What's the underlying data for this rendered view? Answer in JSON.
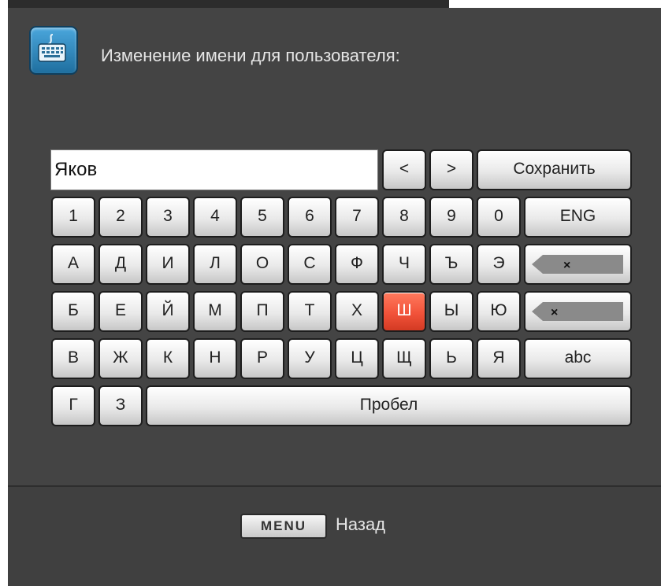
{
  "title": "Изменение имени для пользователя:",
  "input": {
    "value": "Яков"
  },
  "controls": {
    "left": "<",
    "right": ">",
    "save": "Сохранить"
  },
  "digits": [
    "1",
    "2",
    "3",
    "4",
    "5",
    "6",
    "7",
    "8",
    "9",
    "0"
  ],
  "lang_label": "ENG",
  "letters_row1": [
    "А",
    "Д",
    "И",
    "Л",
    "О",
    "С",
    "Ф",
    "Ч",
    "Ъ",
    "Э"
  ],
  "letters_row2": [
    "Б",
    "Е",
    "Й",
    "М",
    "П",
    "Т",
    "Х",
    "Ш",
    "Ы",
    "Ю"
  ],
  "letters_row3": [
    "В",
    "Ж",
    "К",
    "Н",
    "Р",
    "У",
    "Ц",
    "Щ",
    "Ь",
    "Я"
  ],
  "letters_row4": [
    "Г",
    "З"
  ],
  "abc_label": "abc",
  "space_label": "Пробел",
  "backspace_glyph": "×",
  "footer": {
    "menu_label": "MENU",
    "back_label": "Назад"
  },
  "colors": {
    "panel": "#444444",
    "highlight": "#f2533a",
    "icon": "#2a86bf"
  }
}
